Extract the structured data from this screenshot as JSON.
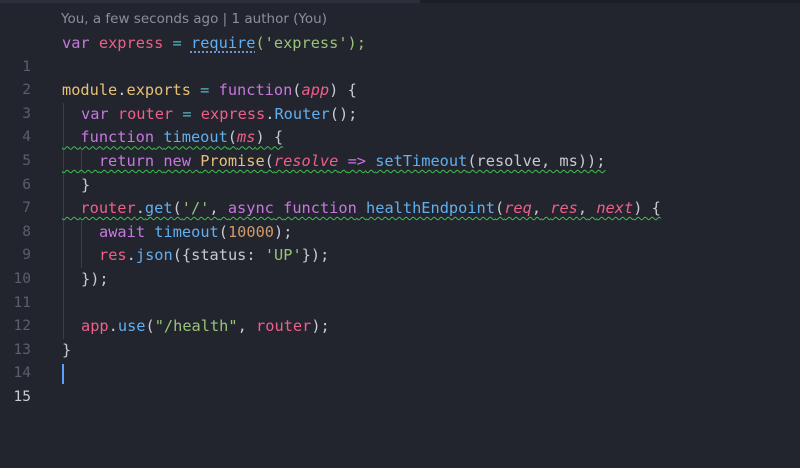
{
  "blame": {
    "text": "You, a few seconds ago | 1 author (You)"
  },
  "editor": {
    "active_line": "15",
    "lines": [
      {
        "n": "1",
        "tokens": [
          "var",
          "express",
          "=",
          "require",
          "('express');"
        ]
      },
      {
        "n": "2"
      },
      {
        "n": "3",
        "tokens": [
          "module",
          ".",
          "exports",
          "=",
          "function",
          "(",
          "app",
          ") {"
        ]
      },
      {
        "n": "4",
        "tokens": [
          "var",
          "router",
          "=",
          "express",
          ".",
          "Router",
          "();"
        ]
      },
      {
        "n": "5",
        "tokens": [
          "function",
          "timeout",
          "(",
          "ms",
          ") {"
        ]
      },
      {
        "n": "6",
        "tokens": [
          "return",
          "new",
          "Promise",
          "(",
          "resolve",
          "=>",
          "setTimeout",
          "(resolve, ms));"
        ]
      },
      {
        "n": "7",
        "tokens": [
          "}"
        ]
      },
      {
        "n": "8",
        "tokens": [
          "router",
          ".",
          "get",
          "(",
          "'/'",
          ",",
          "async",
          "function",
          "healthEndpoint",
          "(",
          "req",
          ",",
          "res",
          ",",
          "next",
          ") {"
        ]
      },
      {
        "n": "9",
        "tokens": [
          "await",
          "timeout",
          "(",
          "10000",
          ");"
        ]
      },
      {
        "n": "10",
        "tokens": [
          "res",
          ".",
          "json",
          "({status:",
          "'UP'",
          "});"
        ]
      },
      {
        "n": "11",
        "tokens": [
          "});"
        ]
      },
      {
        "n": "12"
      },
      {
        "n": "13",
        "tokens": [
          "app",
          ".",
          "use",
          "(",
          "\"/health\"",
          ",",
          "router",
          ");"
        ]
      },
      {
        "n": "14",
        "tokens": [
          "}"
        ]
      },
      {
        "n": "15"
      }
    ]
  },
  "colors": {
    "background": "#23252e",
    "keyword": "#c678dd",
    "identifier": "#ef5f8a",
    "function": "#61afef",
    "string": "#98c379",
    "number": "#d19a66",
    "warning_squiggle": "#3fbf4f",
    "cursor": "#5aa0ff"
  }
}
